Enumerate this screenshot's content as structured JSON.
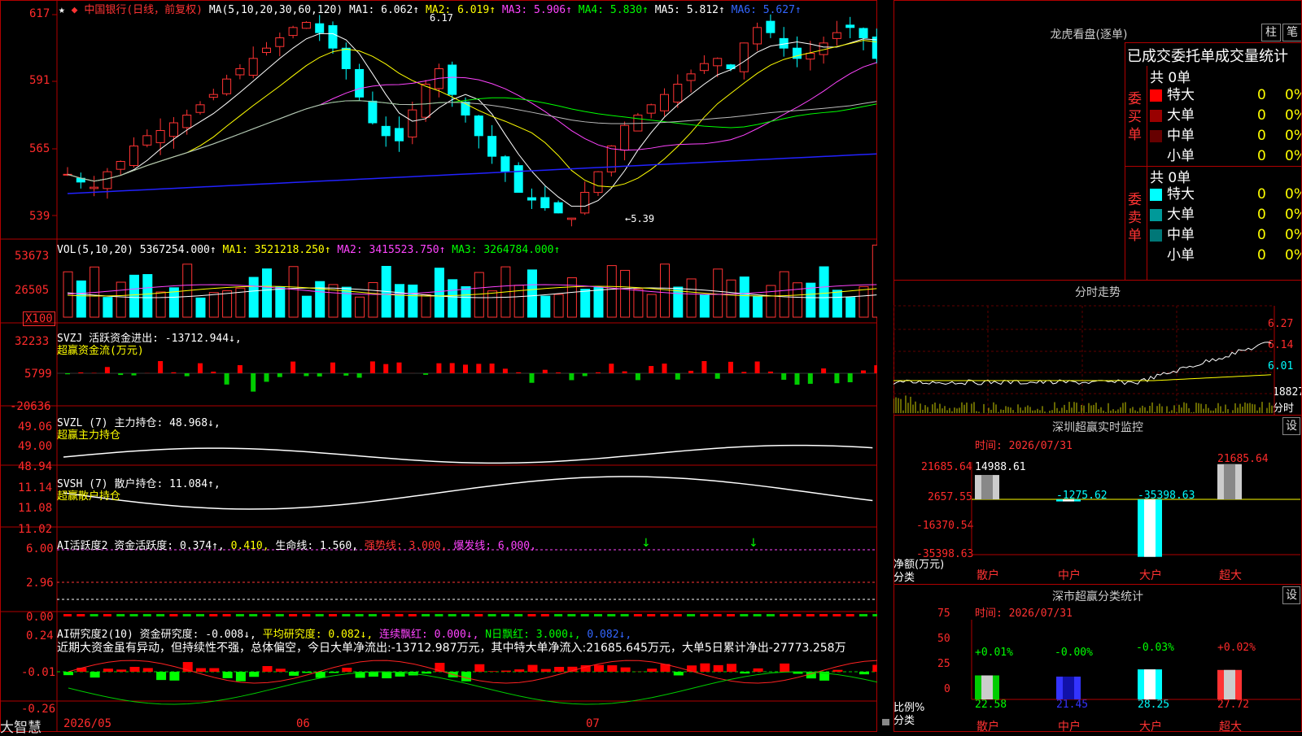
{
  "stock": {
    "name": "中国银行",
    "mode": "(日线，前复权)",
    "ma_label": "MA(5,10,20,30,60,120)",
    "ma1": "MA1: 6.062↑",
    "ma2": "MA2: 6.019↑",
    "ma3": "MA3: 5.906↑",
    "ma4": "MA4: 5.830↑",
    "ma5": "MA5: 5.812↑",
    "ma6": "MA6: 5.627↑",
    "high_note": "6.17",
    "low_note": "←5.39"
  },
  "price_axis": [
    "617",
    "591",
    "565",
    "539"
  ],
  "vol": {
    "label": "VOL(5,10,20)",
    "value": "5367254.000↑",
    "ma1": "MA1: 3521218.250↑",
    "ma2": "MA2: 3415523.750↑",
    "ma3": "MA3: 3264784.000↑",
    "axis": [
      "53673",
      "26505"
    ],
    "unit": "X100"
  },
  "svzj": {
    "label": "SVZJ  活跃资金进出: -13712.944↓,",
    "sub": "超赢资金流(万元)",
    "axis": [
      "32233",
      "5799",
      "-20636"
    ]
  },
  "svzl": {
    "label": "SVZL (7) 主力持仓: 48.968↓,",
    "sub": "超赢主力持仓",
    "axis": [
      "49.06",
      "49.00",
      "48.94"
    ]
  },
  "svsh": {
    "label": "SVSH (7) 散户持仓: 11.084↑,",
    "sub": "超赢散户持仓",
    "axis": [
      "11.14",
      "11.08",
      "11.02"
    ]
  },
  "ai1": {
    "a": "AI活跃度2 资金活跃度: 0.374↑,",
    "b": "0.410,",
    "c": "生命线: 1.560,",
    "d": "强势线: 3.000,",
    "e": "爆发线: 6.000,",
    "axis": [
      "6.00",
      "2.96",
      "0.00"
    ]
  },
  "ai2": {
    "a": "AI研究度2(10) 资金研究度: -0.008↓,",
    "b": "平均研究度: 0.082↓,",
    "c": "连续飘红: 0.000↓,",
    "d": "N日飘红: 3.000↓,",
    "e": "0.082↓,",
    "desc": "近期大资金虽有异动，但持续性不强，总体偏空，今日大单净流出:-13712.987万元，其中特大单净流入:21685.645万元，大单5日累计净出-27773.258万",
    "axis": [
      "0.24",
      "-0.01",
      "-0.26"
    ]
  },
  "date_axis": [
    "2026/05",
    "06",
    "07"
  ],
  "brand": "大智慧",
  "lh": {
    "title": "龙虎看盘(逐单)",
    "btn1": "柱",
    "btn2": "笔",
    "subtitle": "已成交委托单成交量统计",
    "buy_side": "委买单",
    "sell_side": "委卖单",
    "buy_total": "共 0单",
    "sell_total": "共 0单",
    "buy": [
      {
        "label": "特大",
        "val": "0",
        "pct": "0%",
        "color": "#ff0000"
      },
      {
        "label": "大单",
        "val": "0",
        "pct": "0%",
        "color": "#990000"
      },
      {
        "label": "中单",
        "val": "0",
        "pct": "0%",
        "color": "#660000"
      },
      {
        "label": "小单",
        "val": "0",
        "pct": "0%",
        "color": "#000000"
      }
    ],
    "sell": [
      {
        "label": "特大",
        "val": "0",
        "pct": "0%",
        "color": "#00ffff"
      },
      {
        "label": "大单",
        "val": "0",
        "pct": "0%",
        "color": "#009999"
      },
      {
        "label": "中单",
        "val": "0",
        "pct": "0%",
        "color": "#007777"
      },
      {
        "label": "小单",
        "val": "0",
        "pct": "0%",
        "color": "#000000"
      }
    ]
  },
  "intraday": {
    "title": "分时走势",
    "axis": [
      "6.27",
      "6.14",
      "6.01"
    ],
    "vol": "18827",
    "vol_label": "分时"
  },
  "monitor": {
    "title": "深圳超赢实时监控",
    "btn": "设",
    "time": "时间: 2026/07/31",
    "axis": [
      "21685.64",
      "2657.55",
      "-16370.54",
      "-35398.63"
    ],
    "ylabel1": "净额(万元)",
    "ylabel2": "分类",
    "categories": [
      "散户",
      "中户",
      "大户",
      "超大"
    ],
    "values": [
      "14988.61",
      "-1275.62",
      "-35398.63",
      "21685.64"
    ]
  },
  "classify": {
    "title": "深市超赢分类统计",
    "btn": "设",
    "time": "时间: 2026/07/31",
    "axis": [
      "75",
      "50",
      "25",
      "0"
    ],
    "ylabel1": "比例%",
    "ylabel2": "分类",
    "categories": [
      "散户",
      "中户",
      "大户",
      "超大"
    ],
    "changes": [
      "+0.01%",
      "-0.00%",
      "-0.03%",
      "+0.02%"
    ],
    "values": [
      "22.58",
      "21.45",
      "28.25",
      "27.72"
    ]
  },
  "chart_data": [
    {
      "type": "bar",
      "title": "深圳超赢实时监控",
      "categories": [
        "散户",
        "中户",
        "大户",
        "超大"
      ],
      "values": [
        14988.61,
        -1275.62,
        -35398.63,
        21685.64
      ],
      "ylabel": "净额(万元)"
    },
    {
      "type": "bar",
      "title": "深市超赢分类统计",
      "categories": [
        "散户",
        "中户",
        "大户",
        "超大"
      ],
      "values": [
        22.58,
        21.45,
        28.25,
        27.72
      ],
      "ylabel": "比例%",
      "ylim": [
        0,
        75
      ]
    }
  ]
}
